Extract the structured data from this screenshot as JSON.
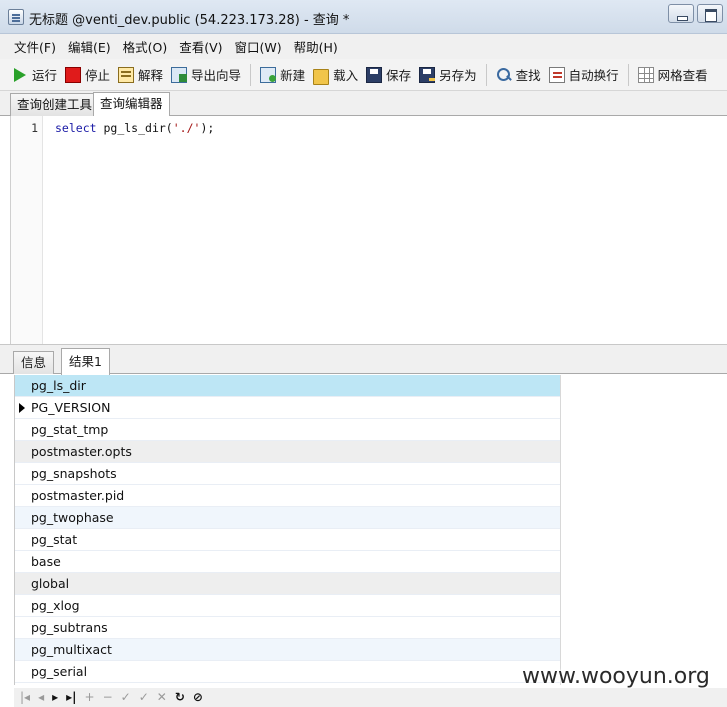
{
  "window": {
    "title": "无标题 @venti_dev.public (54.223.173.28) - 查询 *"
  },
  "menu": [
    "文件(F)",
    "编辑(E)",
    "格式(O)",
    "查看(V)",
    "窗口(W)",
    "帮助(H)"
  ],
  "toolbar": {
    "run": {
      "label": "运行",
      "icon": "play-icon"
    },
    "stop": {
      "label": "停止",
      "icon": "stop-icon"
    },
    "explain": {
      "label": "解释",
      "icon": "explain-icon"
    },
    "export": {
      "label": "导出向导",
      "icon": "export-icon"
    },
    "new": {
      "label": "新建",
      "icon": "new-icon"
    },
    "load": {
      "label": "载入",
      "icon": "folder-icon"
    },
    "save": {
      "label": "保存",
      "icon": "save-icon"
    },
    "save_as": {
      "label": "另存为",
      "icon": "save-as-icon"
    },
    "find": {
      "label": "查找",
      "icon": "magnifier-icon"
    },
    "word_wrap": {
      "label": "自动换行",
      "icon": "wrap-icon"
    },
    "grid_view": {
      "label": "网格查看",
      "icon": "grid-icon"
    }
  },
  "editor_tabs": [
    "查询创建工具",
    "查询编辑器"
  ],
  "editor": {
    "line_number": "1",
    "code": {
      "keyword": "select",
      "func": "pg_ls_dir(",
      "arg": "'./'",
      "end": ");"
    }
  },
  "result_tabs": [
    "信息",
    "结果1"
  ],
  "grid": {
    "header": "pg_ls_dir",
    "rows": [
      "PG_VERSION",
      "pg_stat_tmp",
      "postmaster.opts",
      "pg_snapshots",
      "postmaster.pid",
      "pg_twophase",
      "pg_stat",
      "base",
      "global",
      "pg_xlog",
      "pg_subtrans",
      "pg_multixact",
      "pg_serial"
    ],
    "current_row": "PG_VERSION",
    "colors": {
      "header_bg": "#bde6f5",
      "alt_bg": "#eeeeee",
      "light_bg": "#f0f6fc"
    }
  },
  "watermark": "www.wooyun.org"
}
